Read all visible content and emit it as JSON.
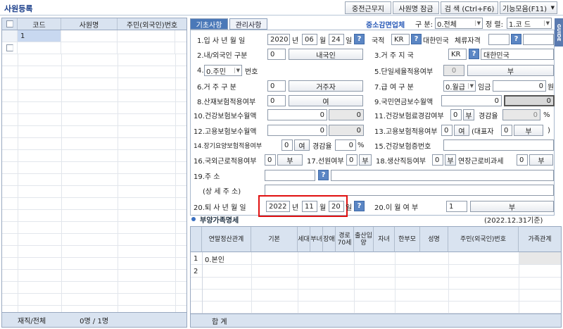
{
  "window": {
    "title": "사원등록"
  },
  "toolbar": {
    "b1": "중전근무지",
    "b2": "사원명 잠금",
    "b3": "검  색 (Ctrl+F6)",
    "b4": "기능모음(F11)"
  },
  "left": {
    "cols": [
      "코드",
      "사원명",
      "주민(외국인)번호"
    ],
    "rows": [
      {
        "code": "1",
        "name": "",
        "ssn": ""
      }
    ],
    "footer_label": "재직/전체",
    "footer_value": "0명 / 1명"
  },
  "tabs": [
    "기초사항",
    "관리사항"
  ],
  "header": {
    "sme": "중소감면업체",
    "gubun_label": "구 분:",
    "gubun_value": "0.전체",
    "sort_label": "정 렬:",
    "sort_value": "1.코 드",
    "guide": "GUIDE"
  },
  "f1": {
    "label": "1.입 사 년 월 일",
    "y": "2020",
    "yl": "년",
    "m": "06",
    "ml": "월",
    "d": "24",
    "dl": "일"
  },
  "nation": {
    "label": "국적",
    "code": "KR",
    "name": "대한민국",
    "stay": "체류자격"
  },
  "f2": {
    "label": "2.내/외국인 구분",
    "code": "0",
    "value": "내국인"
  },
  "f3": {
    "label": "3.거  주  지  국",
    "code": "KR",
    "name": "대한민국"
  },
  "f4": {
    "prefix": "4.",
    "type": "0.주민",
    "label": "번호"
  },
  "f5": {
    "label": "5.단일세율적용여부",
    "code": "0",
    "value": "부"
  },
  "f6": {
    "label": "6.거   주   구   분",
    "code": "0",
    "value": "거주자"
  },
  "f7": {
    "label": "7.급    여    구    분",
    "type": "0.월급",
    "wage_label": "임금",
    "wage": "0",
    "unit": "원"
  },
  "f8": {
    "label": "8.산재보험적용여부",
    "code": "0",
    "value": "여"
  },
  "f9": {
    "label": "9.국민연금보수월액",
    "v1": "0",
    "v2": "0"
  },
  "f10": {
    "label": "10.건강보험보수월액",
    "v1": "0",
    "v2": "0"
  },
  "f11": {
    "label": "11.건강보험료경감여부",
    "code": "0",
    "value": "부",
    "rate_label": "경감율",
    "rate": "0",
    "pct": "%"
  },
  "f12": {
    "label": "12.고용보험보수월액",
    "v1": "0",
    "v2": "0"
  },
  "f13": {
    "label": "13.고용보험적용여부",
    "code": "0",
    "value": "여",
    "rep_label": "(대표자",
    "rep_code": "0",
    "rep_value": "부",
    "close": ")"
  },
  "f14": {
    "label": "14.장기요양보험적용여부",
    "code": "0",
    "value": "여",
    "rate_label": "경감율",
    "rate": "0",
    "pct": "%"
  },
  "f15": {
    "label": "15.건강보험증번호"
  },
  "f16": {
    "label": "16.국외근로적용여부",
    "code": "0",
    "value": "부"
  },
  "f17": {
    "label": "17.선원여부",
    "code": "0",
    "value": "부"
  },
  "f18": {
    "label": "18.생산직등여부",
    "code": "0",
    "value": "부",
    "ot_label": "연장근로비과세",
    "ot_code": "0",
    "ot_value": "부"
  },
  "f19": {
    "label": "19.주               소",
    "detail": "(상 세 주 소)"
  },
  "f20": {
    "label": "20.퇴 사 년 월 일",
    "y": "2022",
    "yl": "년",
    "m": "11",
    "ml": "월",
    "d": "20",
    "dl": "일"
  },
  "f20b": {
    "label": "20.이   월   여   부",
    "code": "1",
    "value": "부"
  },
  "family": {
    "title": "부양가족명세",
    "basis": "(2022.12.31기준)",
    "cols": [
      "연말정산관계",
      "기본",
      "세대",
      "부녀",
      "장애",
      "경로70세",
      "출산입양",
      "자녀",
      "한부모",
      "성명",
      "주민(외국인)번호",
      "가족관계"
    ],
    "rows": [
      {
        "no": "1",
        "rel": "0.본인"
      },
      {
        "no": "2",
        "rel": ""
      }
    ],
    "total": "합   계"
  }
}
